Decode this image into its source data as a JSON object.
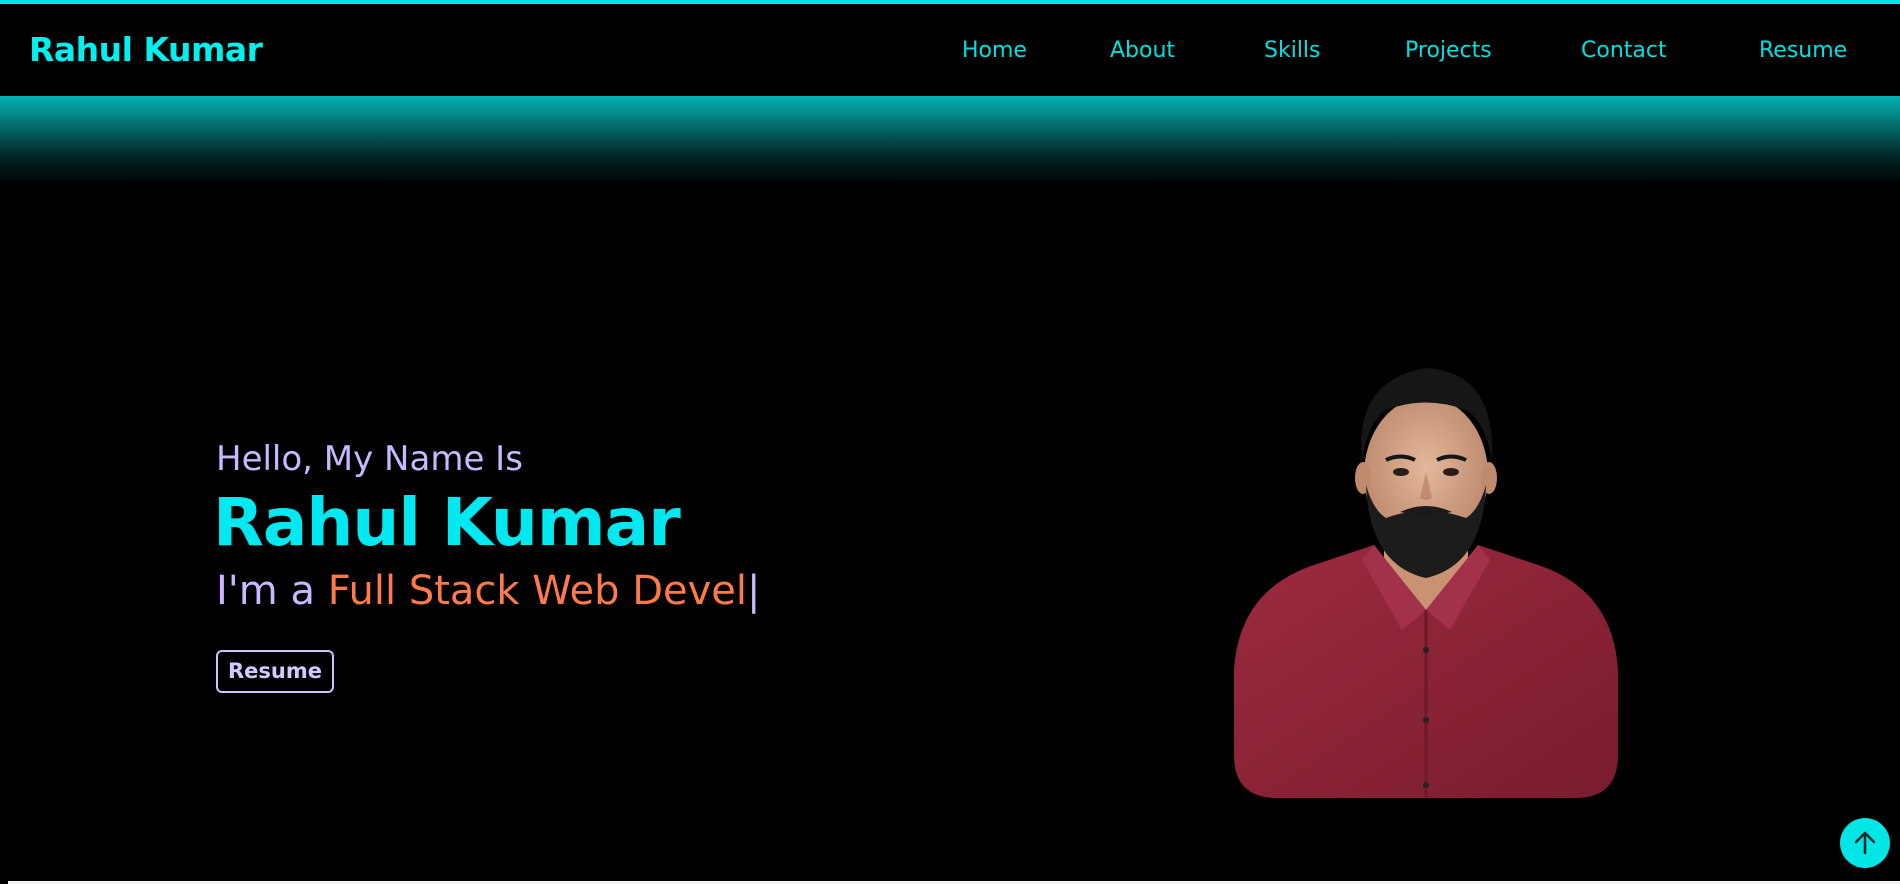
{
  "navbar": {
    "logo": "Rahul Kumar",
    "links": [
      "Home",
      "About",
      "Skills",
      "Projects",
      "Contact",
      "Resume"
    ]
  },
  "hero": {
    "greeting": "Hello, My Name Is",
    "name": "Rahul Kumar",
    "role_prefix": "I'm a ",
    "role_typed": "Full Stack Web Devel",
    "cursor": "|",
    "resume_button": "Resume"
  },
  "colors": {
    "accent": "#00e5e5",
    "greeting": "#c9b8ff",
    "typed_role": "#ff7a4a",
    "background": "#000000"
  },
  "icons": {
    "scroll_top": "arrow-up-icon",
    "portrait": "profile-photo"
  }
}
